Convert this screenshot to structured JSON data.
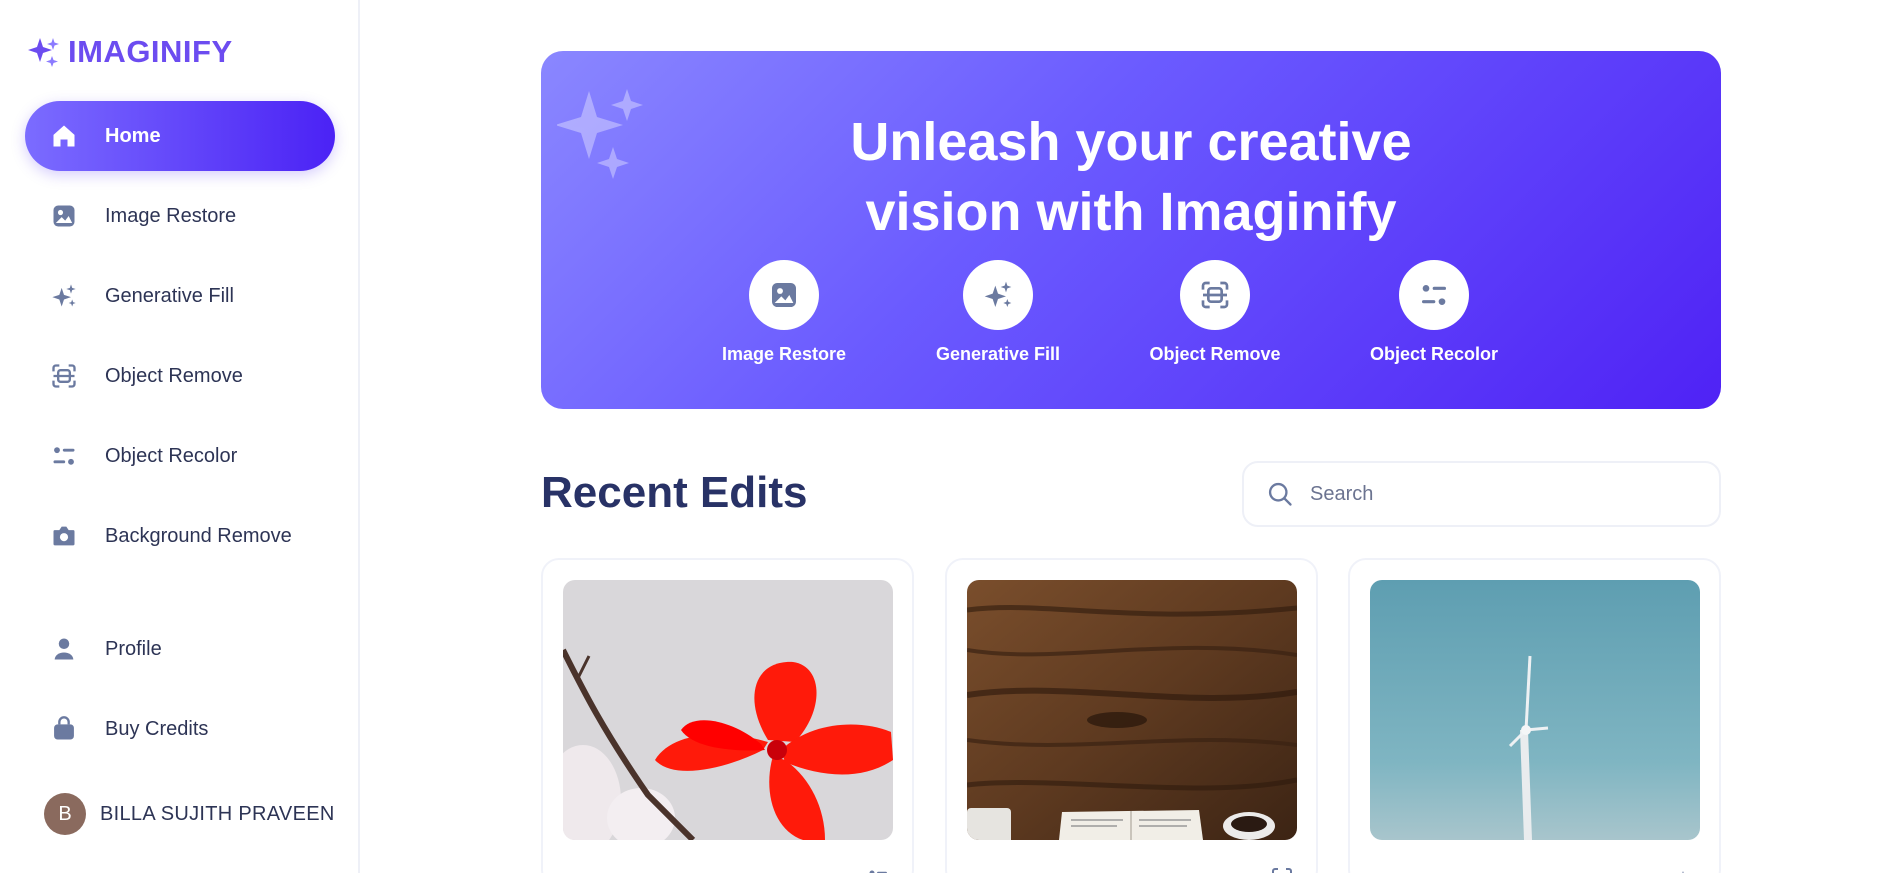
{
  "app": {
    "name": "IMAGINIFY",
    "accent": "#6c4cf0",
    "active_gradient": [
      "#7b6cff",
      "#4b22f5"
    ]
  },
  "sidebar": {
    "items": [
      {
        "label": "Home",
        "icon": "home-icon",
        "active": true
      },
      {
        "label": "Image Restore",
        "icon": "image-icon"
      },
      {
        "label": "Generative Fill",
        "icon": "stars-icon"
      },
      {
        "label": "Object Remove",
        "icon": "scan-icon"
      },
      {
        "label": "Object Recolor",
        "icon": "filter-icon"
      },
      {
        "label": "Background Remove",
        "icon": "camera-icon"
      }
    ],
    "secondary": [
      {
        "label": "Profile",
        "icon": "user-icon"
      },
      {
        "label": "Buy Credits",
        "icon": "bag-icon"
      }
    ],
    "user": {
      "initial": "B",
      "name": "BILLA SUJITH PRAVEEN"
    }
  },
  "hero": {
    "title_line1": "Unleash your creative",
    "title_line2": "vision with Imaginify",
    "tools": [
      {
        "label": "Image Restore",
        "icon": "image-icon"
      },
      {
        "label": "Generative Fill",
        "icon": "stars-icon"
      },
      {
        "label": "Object Remove",
        "icon": "scan-icon"
      },
      {
        "label": "Object Recolor",
        "icon": "filter-icon"
      }
    ]
  },
  "recent": {
    "title": "Recent Edits",
    "search_placeholder": "Search",
    "cards": [
      {
        "image": "red-flower-photo",
        "type_icon": "filter-icon"
      },
      {
        "image": "wooden-table-photo",
        "type_icon": "scan-icon"
      },
      {
        "image": "wind-turbine-photo",
        "type_icon": "stars-icon"
      }
    ]
  }
}
